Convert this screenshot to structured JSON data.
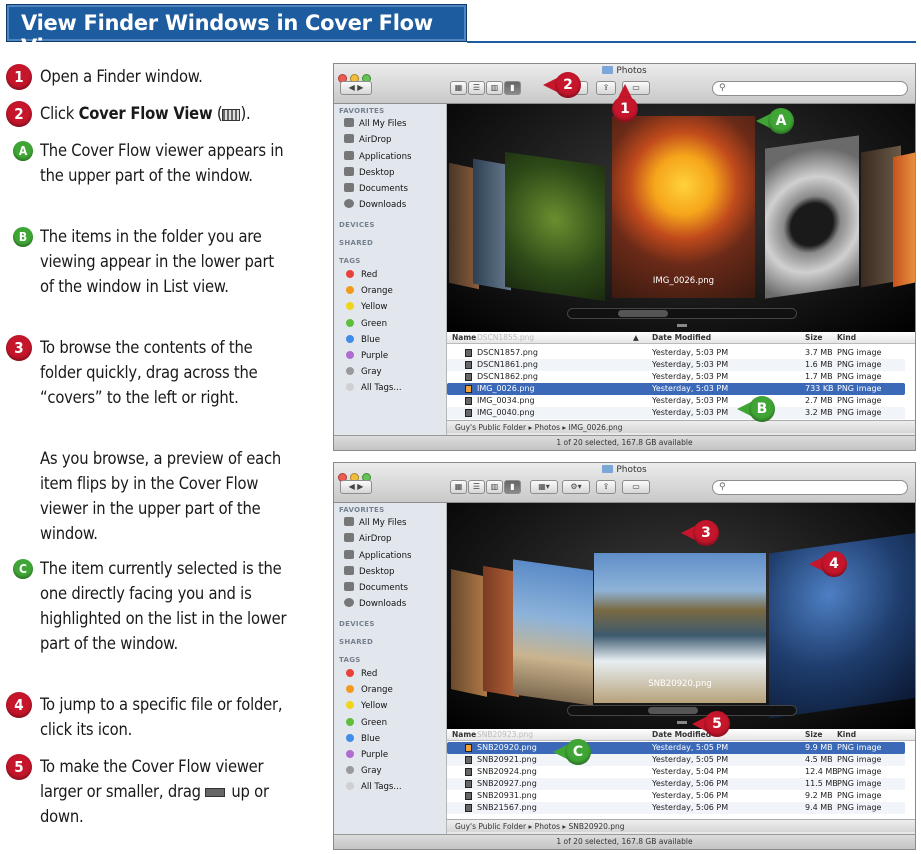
{
  "title": "View Finder Windows in Cover Flow View",
  "steps": [
    {
      "marker": "1",
      "text": "Open a Finder window."
    },
    {
      "marker": "2",
      "text_pre": "Click ",
      "text_bold": "Cover Flow View",
      "text_post": ")."
    },
    {
      "marker": "A",
      "text": "The Cover Flow viewer appears in the upper part of the window."
    },
    {
      "marker": "B",
      "text": "The items in the folder you are viewing appear in the lower part of the window in List view."
    },
    {
      "marker": "3",
      "text": "To browse the contents of the folder quickly, drag across the “covers” to the left or right."
    },
    {
      "marker": "",
      "text": "As you browse, a preview of each item flips by in the Cover Flow viewer in the upper part of the window."
    },
    {
      "marker": "C",
      "text": "The item currently selected is the one directly facing you and is highlighted on the list in the lower part of the window."
    },
    {
      "marker": "4",
      "text": "To jump to a specific file or folder, click its icon."
    },
    {
      "marker": "5",
      "text": "To make the Cover Flow viewer larger or smaller, drag",
      "text_post": "up or down."
    }
  ],
  "sidebar": {
    "favorites_heading": "FAVORITES",
    "favorites": [
      "All My Files",
      "AirDrop",
      "Applications",
      "Desktop",
      "Documents",
      "Downloads"
    ],
    "devices_heading": "DEVICES",
    "shared_heading": "SHARED",
    "tags_heading": "TAGS",
    "tags": [
      {
        "label": "Red",
        "color": "#e8423b"
      },
      {
        "label": "Orange",
        "color": "#f39a1e"
      },
      {
        "label": "Yellow",
        "color": "#f2d41c"
      },
      {
        "label": "Green",
        "color": "#5fbf3c"
      },
      {
        "label": "Blue",
        "color": "#3f8de8"
      },
      {
        "label": "Purple",
        "color": "#b06ad0"
      },
      {
        "label": "Gray",
        "color": "#9a9a9a"
      },
      {
        "label": "All Tags...",
        "color": "#d0d0d0"
      }
    ]
  },
  "window1": {
    "title": "Photos",
    "search_placeholder": "",
    "preview_label": "IMG_0026.png",
    "columns": [
      "Name",
      "Date Modified",
      "Size",
      "Kind"
    ],
    "partial_row": "DSCN1855.png",
    "rows": [
      {
        "name": "DSCN1857.png",
        "date": "Yesterday, 5:03 PM",
        "size": "3.7 MB",
        "kind": "PNG image",
        "selected": false
      },
      {
        "name": "DSCN1861.png",
        "date": "Yesterday, 5:03 PM",
        "size": "1.6 MB",
        "kind": "PNG image",
        "selected": false
      },
      {
        "name": "DSCN1862.png",
        "date": "Yesterday, 5:03 PM",
        "size": "1.7 MB",
        "kind": "PNG image",
        "selected": false
      },
      {
        "name": "IMG_0026.png",
        "date": "Yesterday, 5:03 PM",
        "size": "733 KB",
        "kind": "PNG image",
        "selected": true
      },
      {
        "name": "IMG_0034.png",
        "date": "Yesterday, 5:03 PM",
        "size": "2.7 MB",
        "kind": "PNG image",
        "selected": false
      },
      {
        "name": "IMG_0040.png",
        "date": "Yesterday, 5:03 PM",
        "size": "3.2 MB",
        "kind": "PNG image",
        "selected": false
      }
    ],
    "path": [
      "Guy's Public Folder",
      "Photos",
      "IMG_0026.png"
    ],
    "status": "1 of 20 selected, 167.8 GB available"
  },
  "window2": {
    "title": "Photos",
    "preview_label": "SNB20920.png",
    "columns": [
      "Name",
      "Date Modified",
      "Size",
      "Kind"
    ],
    "partial_row": "SNB20923.png",
    "rows": [
      {
        "name": "SNB20920.png",
        "date": "Yesterday, 5:05 PM",
        "size": "9.9 MB",
        "kind": "PNG image",
        "selected": true
      },
      {
        "name": "SNB20921.png",
        "date": "Yesterday, 5:05 PM",
        "size": "4.5 MB",
        "kind": "PNG image",
        "selected": false
      },
      {
        "name": "SNB20924.png",
        "date": "Yesterday, 5:04 PM",
        "size": "12.4 MB",
        "kind": "PNG image",
        "selected": false
      },
      {
        "name": "SNB20927.png",
        "date": "Yesterday, 5:06 PM",
        "size": "11.5 MB",
        "kind": "PNG image",
        "selected": false
      },
      {
        "name": "SNB20931.png",
        "date": "Yesterday, 5:06 PM",
        "size": "9.2 MB",
        "kind": "PNG image",
        "selected": false
      },
      {
        "name": "SNB21567.png",
        "date": "Yesterday, 5:06 PM",
        "size": "9.4 MB",
        "kind": "PNG image",
        "selected": false
      }
    ],
    "path": [
      "Guy's Public Folder",
      "Photos",
      "SNB20920.png"
    ],
    "status": "1 of 20 selected, 167.8 GB available"
  },
  "callouts": {
    "w1": [
      "2",
      "1",
      "A",
      "B"
    ],
    "w2": [
      "3",
      "4",
      "5",
      "C"
    ]
  }
}
